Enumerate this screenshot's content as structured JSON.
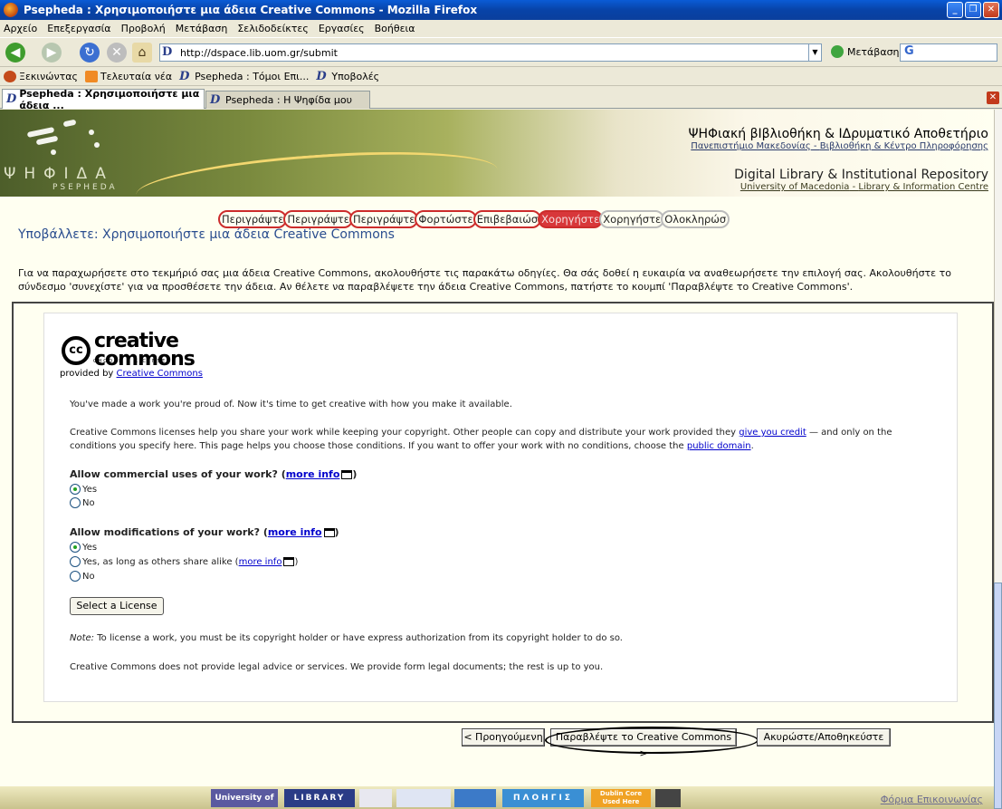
{
  "window": {
    "title": "Psepheda : Χρησιμοποιήστε μια άδεια Creative Commons - Mozilla Firefox"
  },
  "menu": [
    "Αρχείο",
    "Επεξεργασία",
    "Προβολή",
    "Μετάβαση",
    "Σελιδοδείκτες",
    "Εργασίες",
    "Βοήθεια"
  ],
  "nav": {
    "url": "http://dspace.lib.uom.gr/submit",
    "go_label": "Μετάβαση"
  },
  "bookmarks": [
    "Ξεκινώντας",
    "Τελευταία νέα",
    "Psepheda : Τόμοι Επι...",
    "Υποβολές"
  ],
  "tabs": [
    "Psepheda : Χρησιμοποιήστε μια άδεια ...",
    "Psepheda : Η Ψηφίδα μου"
  ],
  "header": {
    "logo_text": "ΨΗΦΙΔΑ",
    "logo_sub": "PSEPHEDA",
    "greek_title": "ΨΗΦιακή βΙβλιοθήκη & ΙΔρυματικό Αποθετήριο",
    "greek_sub_1": "Πανεπιστήμιο Μακεδονίας",
    "greek_sub_2": "Βιβλιοθήκη & Κέντρο Πληροφόρησης",
    "en_title": "Digital Library & Institutional Repository",
    "en_sub_1": "University of Macedonia",
    "en_sub_2": "Library & Information Centre"
  },
  "steps": [
    "Περιγράψτε",
    "Περιγράψτε",
    "Περιγράψτε",
    "Φορτώστε",
    "Επιβεβαιώσ",
    "Χορηγήστε",
    "Χορηγήστε",
    "Ολοκληρώσ"
  ],
  "page": {
    "title": "Υποβάλλετε: Χρησιμοποιήστε μια άδεια Creative Commons",
    "intro": "Για να παραχωρήσετε στο τεκμήριό σας μια άδεια Creative Commons, ακολουθήστε τις παρακάτω οδηγίες. Θα σάς δοθεί η ευκαιρία να αναθεωρήσετε την επιλογή σας. Ακολουθήστε το σύνδεσμο 'συνεχίστε' για να προσθέσετε την άδεια. Αν θέλετε να παραβλέψετε την άδεια Creative Commons, πατήστε το κουμπί 'Παραβλέψτε το Creative Commons'."
  },
  "cc": {
    "logo_top": "creative",
    "logo_bottom": "commons",
    "tagline": "CHOOSE A LICENSE",
    "provided_by": "provided by",
    "provided_link": "Creative Commons",
    "p1": "You've made a work you're proud of. Now it's time to get creative with how you make it available.",
    "p2_a": "Creative Commons licenses help you share your work while keeping your copyright. Other people can copy and distribute your work provided they",
    "p2_link1": "give you credit",
    "p2_b": "— and only on the conditions you specify here. This page helps you choose those conditions. If you want to offer your work with no conditions, choose the",
    "p2_link2": "public domain",
    "p2_c": ".",
    "q1": "Allow commercial uses of your work?",
    "q2": "Allow modifications of your work?",
    "more_info": "more info",
    "opt_yes": "Yes",
    "opt_no": "No",
    "opt_share_alike": "Yes, as long as others share alike",
    "select_label": "Select a License",
    "note_label": "Note:",
    "note_text": "To license a work, you must be its copyright holder or have express authorization from its copyright holder to do so.",
    "disclaimer": "Creative Commons does not provide legal advice or services. We provide form legal documents; the rest is up to you."
  },
  "buttons": {
    "prev": "< Προηγούμενη",
    "skip": "Παραβλέψτε το Creative Commons >",
    "cancel": "Ακυρώστε/Αποθηκεύστε"
  },
  "footer": {
    "badges": [
      "University of Macedonia",
      "LIBRARY",
      "",
      "",
      "",
      "ΠΛΟΗΓΙΣ",
      "Dublin Core Used Here",
      ""
    ],
    "contact": "Φόρμα Επικοινωνίας"
  }
}
